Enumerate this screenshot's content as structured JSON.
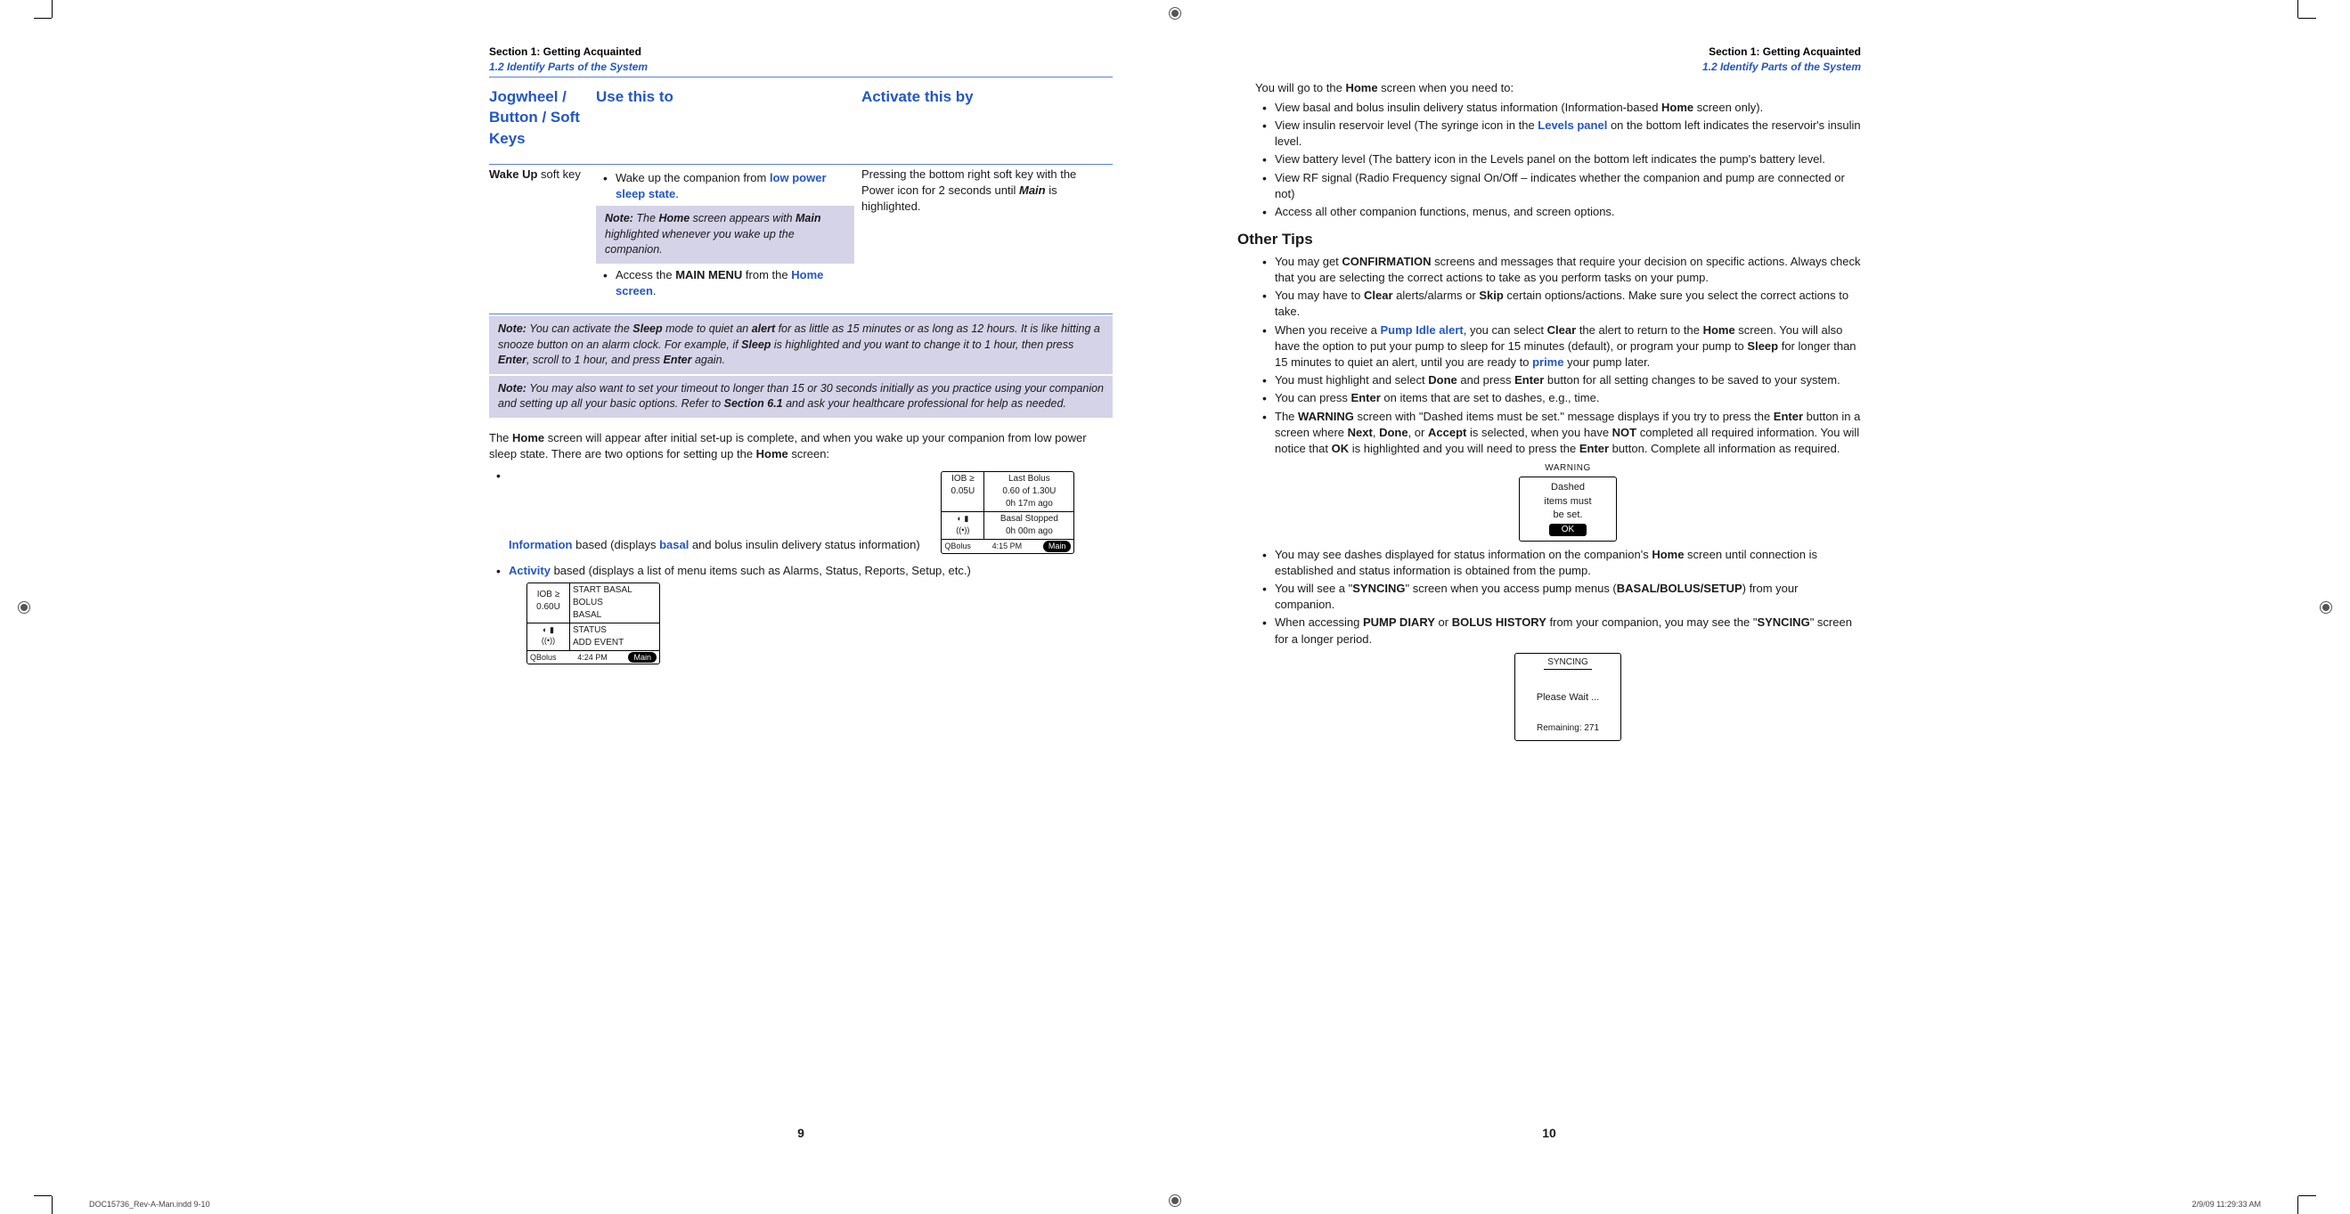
{
  "header_left": {
    "section": "Section 1: Getting Acquainted",
    "sub": "1.2 Identify Parts of the System"
  },
  "header_right": {
    "section": "Section 1: Getting Acquainted",
    "sub": "1.2 Identify Parts of the System"
  },
  "table": {
    "headers": {
      "c1": "Jogwheel / Button / Soft Keys",
      "c2": "Use this to",
      "c3": "Activate this by"
    },
    "row": {
      "c1_bold": "Wake Up",
      "c1_rest": " soft key",
      "c2_bullet1_a": "Wake up the companion from ",
      "c2_bullet1_link": "low power sleep state",
      "c2_bullet1_b": ".",
      "c2_note_a": "Note:",
      "c2_note_b": " The ",
      "c2_note_c": "Home",
      "c2_note_d": " screen appears with ",
      "c2_note_e": "Main",
      "c2_note_f": " highlighted whenever you wake up the companion.",
      "c2_bullet2_a": "Access the ",
      "c2_bullet2_b": "MAIN MENU",
      "c2_bullet2_c": " from the ",
      "c2_bullet2_link": "Home screen",
      "c2_bullet2_d": ".",
      "c3_a": "Pressing the bottom right soft key with the Power icon for 2 seconds until ",
      "c3_b": "Main",
      "c3_c": " is highlighted."
    }
  },
  "note1": {
    "label": "Note:",
    "a": " You can activate the ",
    "b": "Sleep",
    "c": " mode to quiet an ",
    "d": "alert",
    "e": " for as little as 15 minutes or as long as 12 hours. It is like hitting a snooze button on an alarm clock. For example, if ",
    "f": "Sleep",
    "g": " is highlighted and you want to change it to 1 hour, then press ",
    "h": "Enter",
    "i": ", scroll to 1 hour, and press ",
    "j": "Enter",
    "k": " again."
  },
  "note2": {
    "label": "Note:",
    "a": " You may also want to set your timeout to longer than 15 or 30 seconds initially as you practice using your companion and setting up all your basic options. Refer to ",
    "b": "Section 6.1",
    "c": " and ask your healthcare professional for help as needed."
  },
  "para1": {
    "a": "The ",
    "b": "Home",
    "c": " screen will appear after initial set-up is complete, and when you wake up your companion from low power sleep state. There are two options for setting up the ",
    "d": "Home",
    "e": " screen:"
  },
  "opt1": {
    "link": "Information",
    "a": " based (displays ",
    "link2": "basal",
    "b": " and bolus insulin delivery status information)"
  },
  "screen1": {
    "iob_l": "IOB ≥",
    "iob_v": "0.05U",
    "lb": "Last Bolus",
    "lb_v": "0.60 of 1.30U",
    "lb_t": "0h 17m ago",
    "bs": "Basal Stopped",
    "bs_t": "0h 00m ago",
    "qb": "QBolus",
    "time": "4:15 PM",
    "main": "Main"
  },
  "opt2": {
    "link": "Activity",
    "a": " based (displays a list of menu items such as Alarms, Status, Reports, Setup, etc.)"
  },
  "screen2": {
    "iob_l": "IOB ≥",
    "iob_v": "0.60U",
    "m1": "START BASAL",
    "m2": "BOLUS",
    "m3": "BASAL",
    "m4": "STATUS",
    "m5": "ADD EVENT",
    "qb": "QBolus",
    "time": "4:24 PM",
    "main": "Main"
  },
  "page_left_num": "9",
  "r_intro": "You will go to the Home screen when you need to:",
  "r_intro_a": "You will go to the ",
  "r_intro_b": "Home",
  "r_intro_c": " screen when you need to:",
  "r_b1_a": "View basal and bolus insulin delivery status information (Information-based ",
  "r_b1_b": "Home",
  "r_b1_c": " screen only).",
  "r_b2_a": "View insulin reservoir level (The syringe icon in the ",
  "r_b2_link": "Levels panel",
  "r_b2_b": " on the bottom left indicates the reservoir's insulin level.",
  "r_b3": "View battery level (The battery icon in the Levels panel on the bottom left indicates the pump's battery level.",
  "r_b4": "View RF signal (Radio Frequency signal On/Off – indicates whether the companion and pump are connected or not)",
  "r_b5": "Access all other companion functions, menus, and screen options.",
  "tips_title": "Other Tips",
  "t1_a": "You may get ",
  "t1_b": "CONFIRMATION",
  "t1_c": " screens and messages that require your decision on specific actions. Always check that you are selecting the correct actions to take as you perform tasks on your pump.",
  "t2_a": "You may have to ",
  "t2_b": "Clear",
  "t2_c": " alerts/alarms or ",
  "t2_d": "Skip",
  "t2_e": " certain options/actions. Make sure you select the correct actions to take.",
  "t3_a": "When you receive a ",
  "t3_link": "Pump Idle alert",
  "t3_b": ", you can select ",
  "t3_c": "Clear",
  "t3_d": " the alert to return to the ",
  "t3_e": "Home",
  "t3_f": " screen. You will also have the option to put your pump to sleep for 15 minutes (default), or program your pump to ",
  "t3_g": "Sleep",
  "t3_h": " for longer than 15 minutes to quiet an alert, until you are ready to ",
  "t3_link2": "prime",
  "t3_i": " your pump later.",
  "t4_a": "You must highlight and select ",
  "t4_b": "Done",
  "t4_c": " and press ",
  "t4_d": "Enter",
  "t4_e": " button for all setting changes to be saved to your system.",
  "t5_a": "You can press ",
  "t5_b": "Enter",
  "t5_c": " on items that are set to dashes, e.g., time.",
  "t6_a": "The ",
  "t6_b": "WARNING",
  "t6_c": " screen with \"Dashed items must be set.\" message displays if you try to press the ",
  "t6_d": "Enter",
  "t6_e": " button in a screen where ",
  "t6_f": "Next",
  "t6_g": ", ",
  "t6_h": "Done",
  "t6_i": ", or ",
  "t6_j": "Accept",
  "t6_k": " is selected, when you have ",
  "t6_l": "NOT",
  "t6_m": " completed all required information. You will notice that ",
  "t6_n": "OK",
  "t6_o": " is highlighted and you will need to press the ",
  "t6_p": "Enter",
  "t6_q": " button. Complete all information as required.",
  "warn_box": {
    "title": "WARNING",
    "l1": "Dashed",
    "l2": "items must",
    "l3": "be set.",
    "ok": "OK"
  },
  "t7_a": "You may see dashes displayed for status information on the companion's ",
  "t7_b": "Home",
  "t7_c": " screen until connection is established and status information is obtained from the pump.",
  "t8_a": "You will see a \"",
  "t8_b": "SYNCING",
  "t8_c": "\" screen when you access pump menus (",
  "t8_d": "BASAL/BOLUS/SETUP",
  "t8_e": ") from your companion.",
  "t9_a": "When accessing ",
  "t9_b": "PUMP DIARY",
  "t9_c": " or ",
  "t9_d": "BOLUS HISTORY",
  "t9_e": " from your companion, you may see the \"",
  "t9_f": "SYNCING",
  "t9_g": "\" screen for a longer period.",
  "sync_box": {
    "title": "SYNCING",
    "wait": "Please Wait ...",
    "remain": "Remaining: 271"
  },
  "page_right_num": "10",
  "footer": {
    "file": "DOC15736_Rev-A-Man.indd   9-10",
    "date": "2/9/09   11:29:33 AM"
  }
}
